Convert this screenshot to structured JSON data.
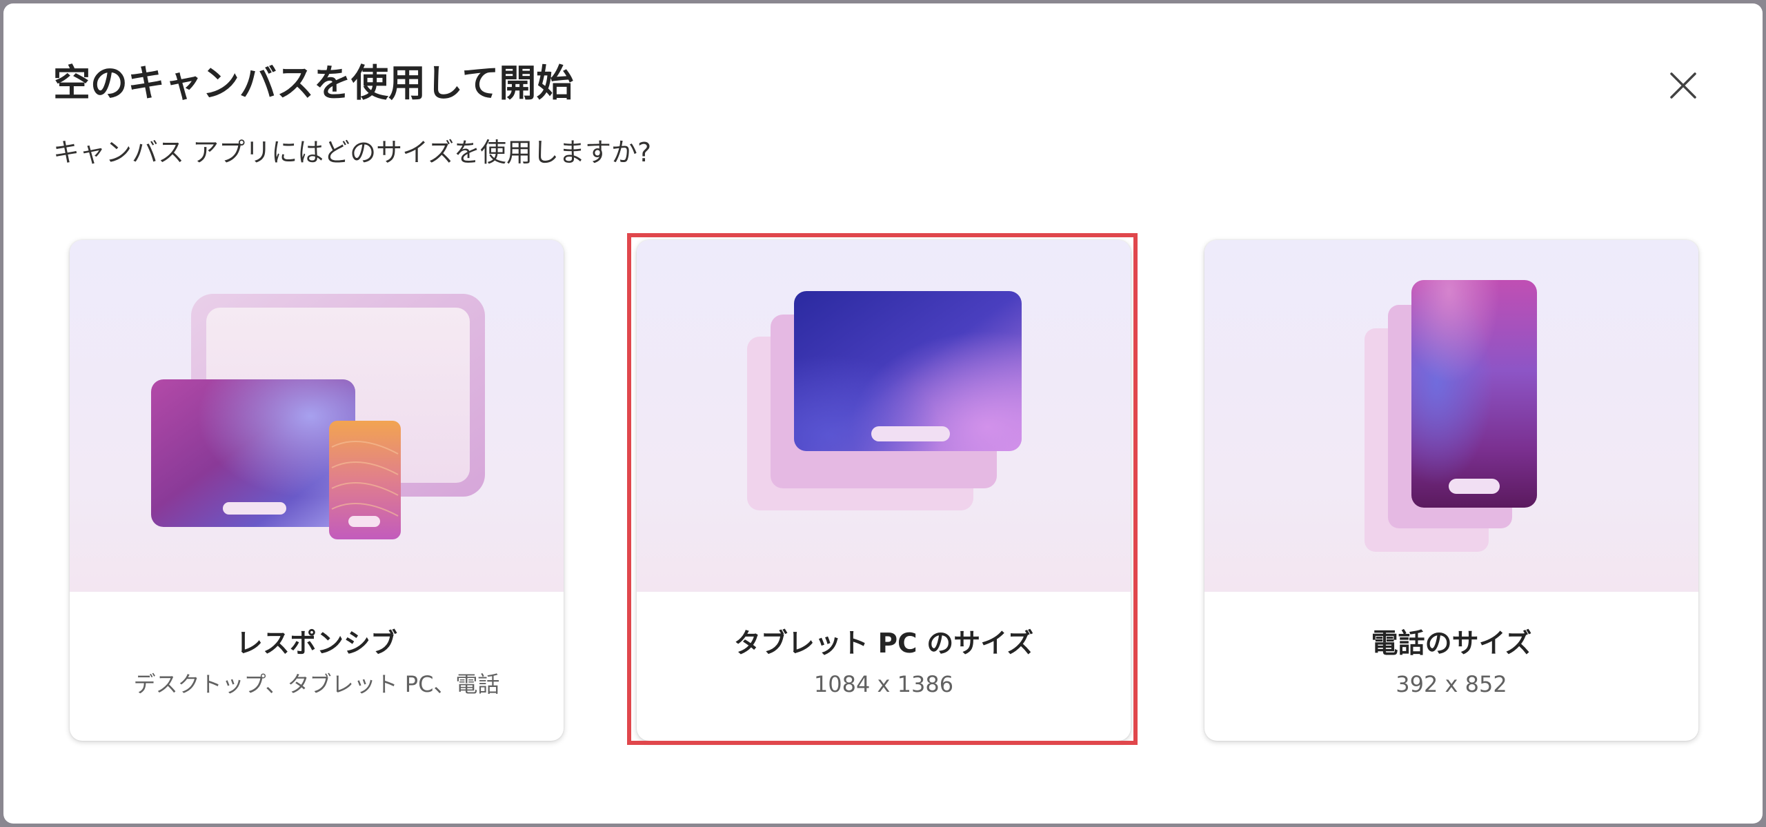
{
  "dialog": {
    "title": "空のキャンバスを使用して開始",
    "subtitle": "キャンバス アプリにはどのサイズを使用しますか?",
    "close_icon": "close-icon"
  },
  "cards": [
    {
      "title": "レスポンシブ",
      "description": "デスクトップ、タブレット PC、電話",
      "illustration": "responsive-devices-illustration",
      "selected": false
    },
    {
      "title": "タブレット PC のサイズ",
      "description": "1084 x 1386",
      "illustration": "tablet-illustration",
      "selected": true
    },
    {
      "title": "電話のサイズ",
      "description": "392 x 852",
      "illustration": "phone-illustration",
      "selected": false
    }
  ],
  "colors": {
    "selection_border": "#e0474c",
    "title_text": "#242424",
    "description_text": "#616161"
  }
}
